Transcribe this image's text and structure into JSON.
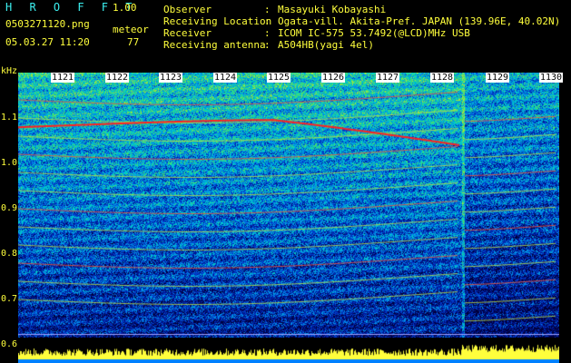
{
  "header": {
    "app_title": "H R O F F T",
    "version": "1.00",
    "file_name": "0503271120.png",
    "mode_label": "meteor",
    "timestamp": "05.03.27 11:20",
    "count": "77"
  },
  "station_info": [
    {
      "key": "Observer",
      "value": "Masayuki Kobayashi"
    },
    {
      "key": "Receiving Location",
      "value": "Ogata-vill. Akita-Pref. JAPAN (139.96E, 40.02N)"
    },
    {
      "key": "Receiver",
      "value": "ICOM IC-575 53.7492(@LCD)MHz USB"
    },
    {
      "key": "Receiving antenna",
      "value": "A504HB(yagi 4el)"
    }
  ],
  "axis": {
    "unit": "kHz",
    "y_ticks": [
      "1.1",
      "1.0",
      "0.9",
      "0.8",
      "0.7",
      "0.6"
    ],
    "x_ticks": [
      "1121",
      "1122",
      "1123",
      "1124",
      "1125",
      "1126",
      "1127",
      "1128",
      "1129",
      "1130"
    ]
  },
  "colors": {
    "text": "#ffff3c",
    "background": "#000000",
    "echo_trace": "#ff2020"
  }
}
